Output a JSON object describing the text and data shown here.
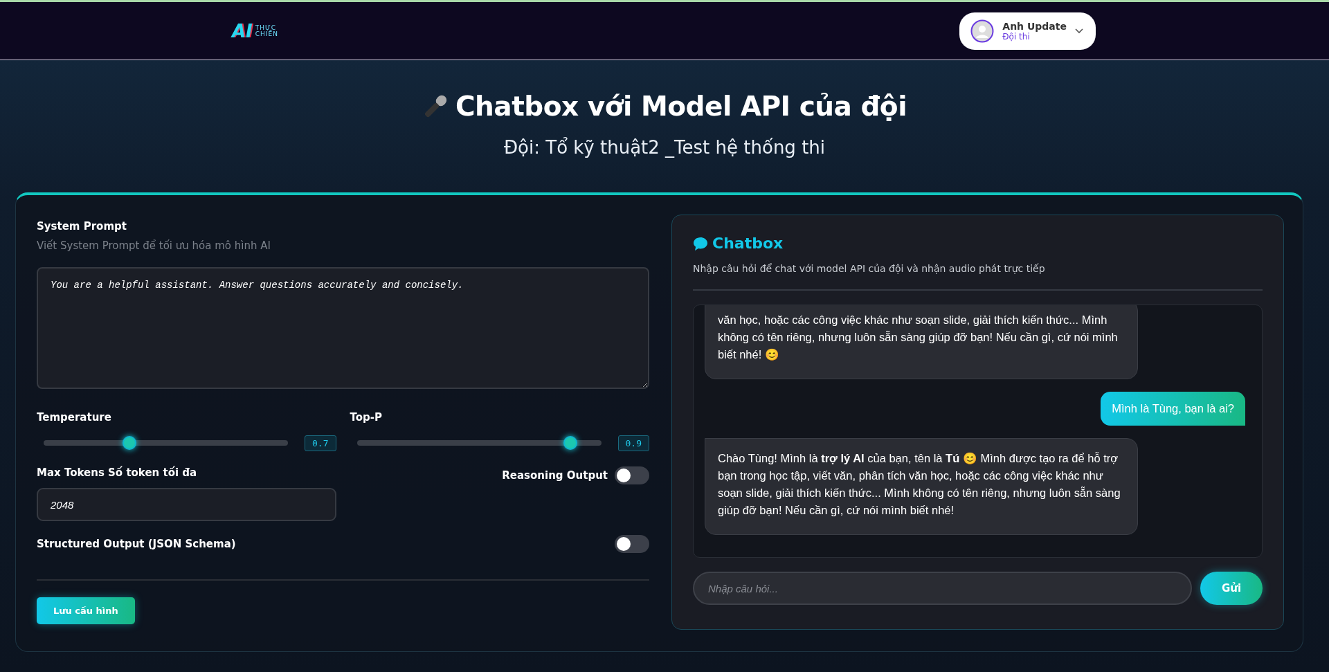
{
  "header": {
    "logo": {
      "mark": "AI",
      "line_1": "THỰC",
      "line_2": "CHIẾN"
    },
    "user": {
      "name": "Anh Update",
      "role": "Đội thi"
    }
  },
  "hero": {
    "title": "Chatbox với Model API của đội",
    "subtitle": "Đội: Tổ kỹ thuật2 _Test hệ thống thi"
  },
  "settings": {
    "system_prompt": {
      "label": "System Prompt",
      "hint": "Viết System Prompt để tối ưu hóa mô hình AI",
      "value": "You are a helpful assistant. Answer questions accurately and concisely."
    },
    "sliders": [
      {
        "label": "Temperature",
        "level": 0.35,
        "reading": "0.7"
      },
      {
        "label": "Top-P",
        "level": 0.875,
        "reading": "0.9"
      }
    ],
    "max_tokens": {
      "label": "Max Tokens Số token tối đa",
      "value": "2048"
    },
    "toggles": [
      {
        "label": "Reasoning Output",
        "on": false
      },
      {
        "label": "Structured Output (JSON Schema)",
        "on": false
      }
    ],
    "save_button": "Lưu cấu hình"
  },
  "chat": {
    "title": "Chatbox",
    "description": "Nhập câu hỏi để chat với model API của đội và nhận audio phát trực tiếp",
    "messages": [
      {
        "kind": "assistant",
        "text": "văn học, hoặc các công việc khác như soạn slide, giải thích kiến thức... Mình không có tên riêng, nhưng luôn sẵn sàng giúp đỡ bạn! Nếu cần gì, cứ nói mình biết nhé! 😊"
      },
      {
        "kind": "user",
        "text": "Mình là Tùng, bạn là ai?"
      },
      {
        "kind": "assistant",
        "text": "Chào Tùng! Mình là **trợ lý AI** của bạn, tên là **Tú** 😊 Mình được tạo ra để hỗ trợ bạn trong học tập, viết văn, phân tích văn học, hoặc các công việc khác như soạn slide, giải thích kiến thức... Mình không có tên riêng, nhưng luôn sẵn sàng giúp đỡ bạn! Nếu cần gì, cứ nói mình biết nhé!"
      }
    ],
    "input": {
      "placeholder": "Nhập câu hỏi..."
    },
    "send_button": "Gửi"
  }
}
